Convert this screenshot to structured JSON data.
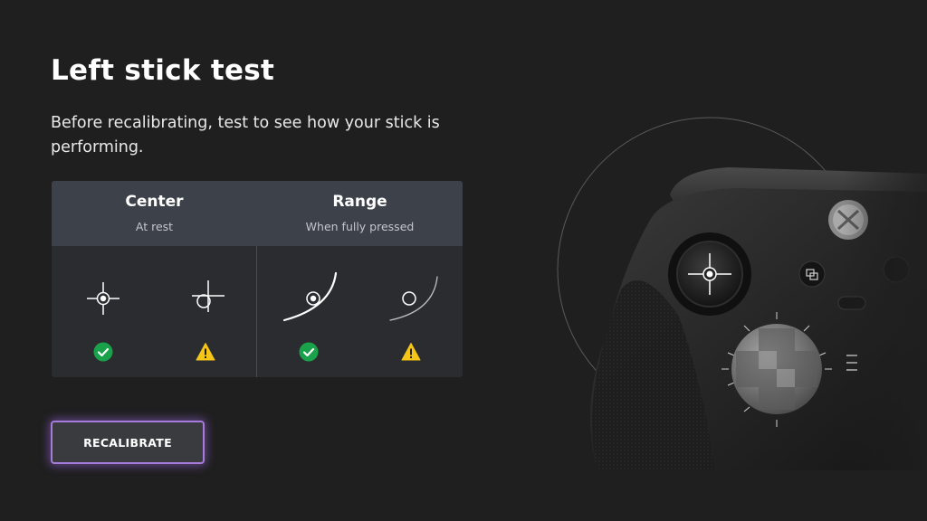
{
  "page": {
    "title": "Left stick test",
    "description": "Before recalibrating, test to see how your stick is performing."
  },
  "test_panel": {
    "columns": [
      {
        "title": "Center",
        "subtitle": "At rest"
      },
      {
        "title": "Range",
        "subtitle": "When fully pressed"
      }
    ],
    "examples": [
      {
        "icon": "centered-crosshair-icon",
        "status": "check-icon"
      },
      {
        "icon": "offset-crosshair-icon",
        "status": "warning-icon"
      },
      {
        "icon": "full-range-arc-icon",
        "status": "check-icon"
      },
      {
        "icon": "short-range-arc-icon",
        "status": "warning-icon"
      }
    ]
  },
  "actions": {
    "recalibrate_label": "RECALIBRATE"
  },
  "illustration": {
    "icon": "elite-controller-image"
  },
  "colors": {
    "background": "#1f1f1f",
    "panel_header": "#3d4149",
    "panel_body": "#2b2c30",
    "success": "#1aa24b",
    "warning": "#f5c518",
    "focus_accent": "#a77bd9"
  }
}
